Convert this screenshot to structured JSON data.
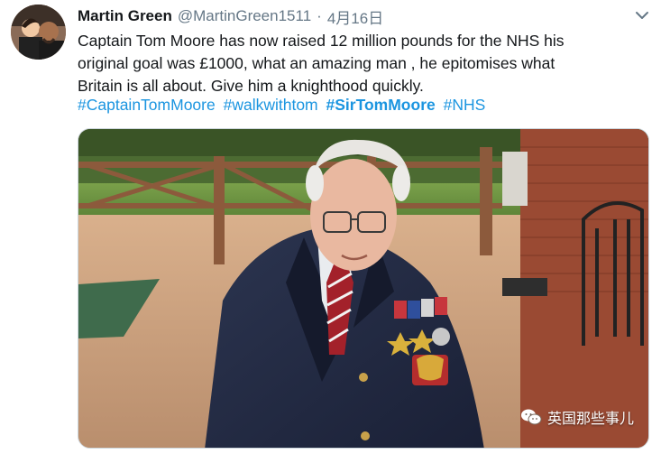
{
  "tweet": {
    "author_name": "Martin Green",
    "author_handle": "@MartinGreen1511",
    "separator": "·",
    "date": "4月16日",
    "text_lines": [
      "Captain Tom Moore has now raised 12 million pounds for the NHS his",
      "original goal was £1000, what an amazing man , he epitomises what",
      "Britain is all about. Give him a knighthood quickly."
    ],
    "hashtags": [
      {
        "label": "#CaptainTomMoore",
        "bold": false
      },
      {
        "label": "#walkwithtom",
        "bold": false
      },
      {
        "label": "#SirTomMoore",
        "bold": true
      },
      {
        "label": "#NHS",
        "bold": false
      }
    ]
  },
  "icons": {
    "menu": "chevron-down-icon",
    "watermark": "wechat-icon"
  },
  "watermark": {
    "text": "英国那些事儿"
  },
  "colors": {
    "link": "#1b95e0",
    "secondary_text": "#657786",
    "primary_text": "#14171a"
  }
}
